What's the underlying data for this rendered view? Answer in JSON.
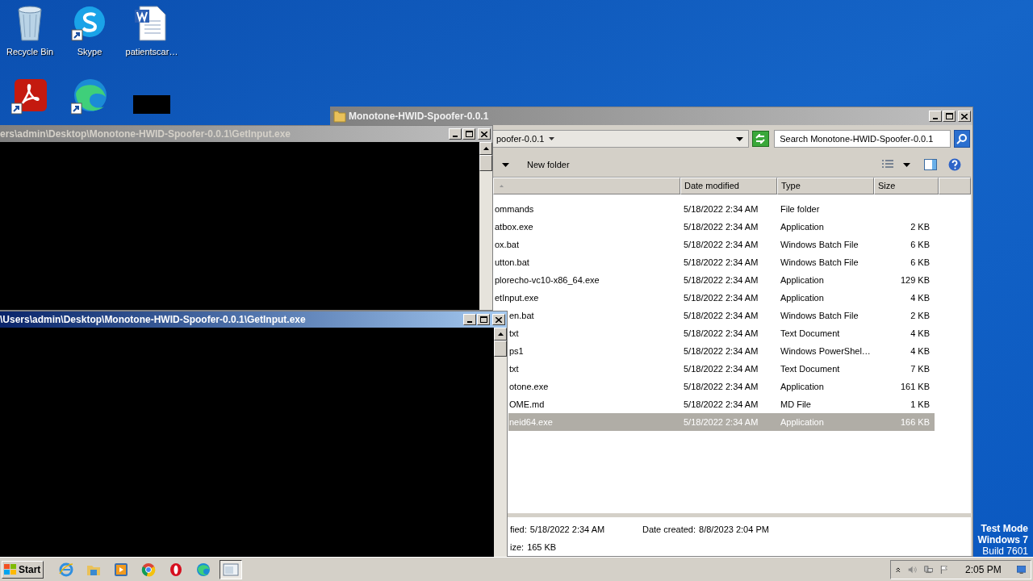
{
  "desktop": {
    "icons": [
      {
        "kind": "recycle",
        "label": "Recycle Bin"
      },
      {
        "kind": "skype",
        "label": "Skype"
      },
      {
        "kind": "word",
        "label": "patientscar…"
      },
      {
        "kind": "acrobat"
      },
      {
        "kind": "edge"
      },
      {
        "kind": "redacted"
      }
    ]
  },
  "system_text": [
    "Test Mode",
    "Windows 7",
    "Build 7601"
  ],
  "explorer": {
    "title": "Monotone-HWID-Spoofer-0.0.1",
    "active": false,
    "address": "poofer-0.0.1",
    "search": {
      "placeholder": "Search Monotone-HWID-Spoofer-0.0.1"
    },
    "toolbar": {
      "new_folder": "New folder"
    },
    "columns": [
      "Date modified",
      "Type",
      "Size"
    ],
    "rows": [
      {
        "name": "ommands",
        "date": "5/18/2022 2:34 AM",
        "type": "File folder",
        "size": "",
        "selected": false
      },
      {
        "name": "atbox.exe",
        "date": "5/18/2022 2:34 AM",
        "type": "Application",
        "size": "2 KB",
        "selected": false
      },
      {
        "name": "ox.bat",
        "date": "5/18/2022 2:34 AM",
        "type": "Windows Batch File",
        "size": "6 KB",
        "selected": false
      },
      {
        "name": "utton.bat",
        "date": "5/18/2022 2:34 AM",
        "type": "Windows Batch File",
        "size": "6 KB",
        "selected": false
      },
      {
        "name": "plorecho-vc10-x86_64.exe",
        "date": "5/18/2022 2:34 AM",
        "type": "Application",
        "size": "129 KB",
        "selected": false
      },
      {
        "name": "etInput.exe",
        "date": "5/18/2022 2:34 AM",
        "type": "Application",
        "size": "4 KB",
        "selected": false
      },
      {
        "name": "en.bat",
        "date": "5/18/2022 2:34 AM",
        "type": "Windows Batch File",
        "size": "2 KB",
        "selected": false
      },
      {
        "name": "txt",
        "date": "5/18/2022 2:34 AM",
        "type": "Text Document",
        "size": "4 KB",
        "selected": false
      },
      {
        "name": "ps1",
        "date": "5/18/2022 2:34 AM",
        "type": "Windows PowerShel…",
        "size": "4 KB",
        "selected": false
      },
      {
        "name": "txt",
        "date": "5/18/2022 2:34 AM",
        "type": "Text Document",
        "size": "7 KB",
        "selected": false
      },
      {
        "name": "otone.exe",
        "date": "5/18/2022 2:34 AM",
        "type": "Application",
        "size": "161 KB",
        "selected": false
      },
      {
        "name": "OME.md",
        "date": "5/18/2022 2:34 AM",
        "type": "MD File",
        "size": "1 KB",
        "selected": false
      },
      {
        "name": "neid64.exe",
        "date": "5/18/2022 2:34 AM",
        "type": "Application",
        "size": "166 KB",
        "selected": true
      }
    ],
    "details": [
      {
        "label": "fied:",
        "value": "5/18/2022 2:34 AM"
      },
      {
        "label": "Date created:",
        "value": "8/8/2023 2:04 PM"
      },
      {
        "label": "ize:",
        "value": "165 KB"
      }
    ]
  },
  "consoles": [
    {
      "title": "ers\\admin\\Desktop\\Monotone-HWID-Spoofer-0.0.1\\GetInput.exe",
      "active": false
    },
    {
      "title": "\\Users\\admin\\Desktop\\Monotone-HWID-Spoofer-0.0.1\\GetInput.exe",
      "active": true
    }
  ],
  "taskbar": {
    "start": "Start",
    "apps": [
      {
        "kind": "ie",
        "selected": false
      },
      {
        "kind": "explorer",
        "selected": false
      },
      {
        "kind": "media",
        "selected": false
      },
      {
        "kind": "chrome",
        "selected": false
      },
      {
        "kind": "opera",
        "selected": false
      },
      {
        "kind": "edge",
        "selected": false
      },
      {
        "kind": "console",
        "selected": true
      }
    ],
    "clock": "2:05 PM"
  }
}
